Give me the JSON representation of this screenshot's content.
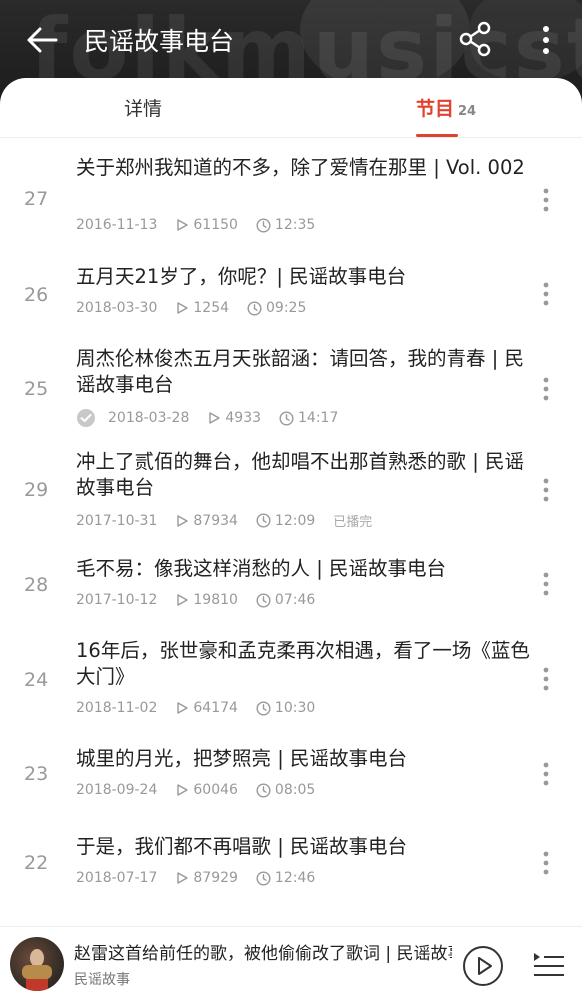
{
  "header": {
    "title": "民谣故事电台",
    "watermark": "folkmusicstory"
  },
  "tabs": {
    "detail_label": "详情",
    "programs_label": "节目",
    "programs_count": "24"
  },
  "episodes": [
    {
      "number": "27",
      "title": "关于郑州我知道的不多，除了爱情在那里 | Vol. 002",
      "date": "2016-11-13",
      "plays": "61150",
      "duration": "12:35"
    },
    {
      "number": "26",
      "title": "五月天21岁了，你呢？| 民谣故事电台",
      "date": "2018-03-30",
      "plays": "1254",
      "duration": "09:25"
    },
    {
      "number": "25",
      "title": "周杰伦林俊杰五月天张韶涵：请回答，我的青春 | 民谣故事电台",
      "date": "2018-03-28",
      "plays": "4933",
      "duration": "14:17",
      "downloaded": true
    },
    {
      "number": "29",
      "title": "冲上了贰佰的舞台，他却唱不出那首熟悉的歌 | 民谣故事电台",
      "date": "2017-10-31",
      "plays": "87934",
      "duration": "12:09",
      "status": "已播完"
    },
    {
      "number": "28",
      "title": "毛不易：像我这样消愁的人 | 民谣故事电台",
      "date": "2017-10-12",
      "plays": "19810",
      "duration": "07:46"
    },
    {
      "number": "24",
      "title": "16年后，张世豪和孟克柔再次相遇，看了一场《蓝色大门》",
      "date": "2018-11-02",
      "plays": "64174",
      "duration": "10:30"
    },
    {
      "number": "23",
      "title": "城里的月光，把梦照亮 | 民谣故事电台",
      "date": "2018-09-24",
      "plays": "60046",
      "duration": "08:05"
    },
    {
      "number": "22",
      "title": "于是，我们都不再唱歌 | 民谣故事电台",
      "date": "2018-07-17",
      "plays": "87929",
      "duration": "12:46"
    }
  ],
  "player": {
    "now_playing": "赵雷这首给前任的歌，被他偷偷改了歌词 | 民谣故事电台",
    "source": "民谣故事"
  },
  "colors": {
    "accent": "#e2412f",
    "header_bg": "#1c1c1c"
  },
  "icons": {
    "back": "arrow-left-icon",
    "share": "share-icon",
    "more": "more-vertical-icon",
    "play_count": "play-triangle-icon",
    "duration": "clock-icon",
    "downloaded": "check-circle-icon",
    "play": "play-circle-icon",
    "playlist": "playlist-icon"
  }
}
